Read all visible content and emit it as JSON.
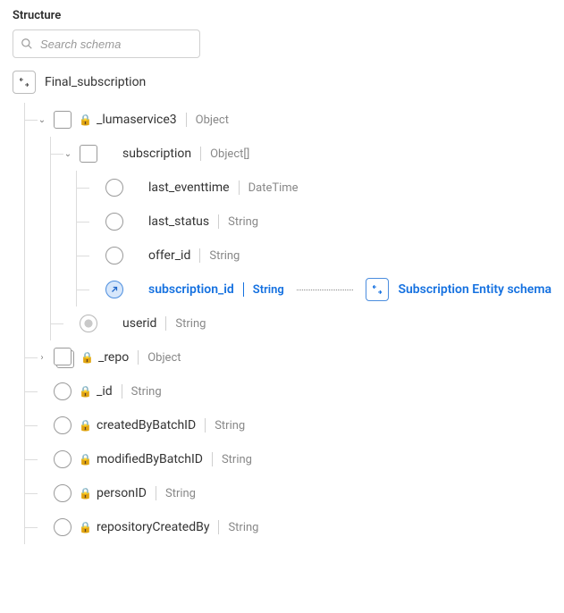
{
  "section_title": "Structure",
  "search": {
    "placeholder": "Search schema"
  },
  "schema": {
    "root": "Final_subscription",
    "n0": {
      "name": "_lumaservice3",
      "type": "Object"
    },
    "n0_0": {
      "name": "subscription",
      "type": "Object[]"
    },
    "n0_0_0": {
      "name": "last_eventtime",
      "type": "DateTime"
    },
    "n0_0_1": {
      "name": "last_status",
      "type": "String"
    },
    "n0_0_2": {
      "name": "offer_id",
      "type": "String"
    },
    "n0_0_3": {
      "name": "subscription_id",
      "type": "String",
      "ref": "Subscription Entity schema"
    },
    "n0_1": {
      "name": "userid",
      "type": "String"
    },
    "n1": {
      "name": "_repo",
      "type": "Object"
    },
    "n2": {
      "name": "_id",
      "type": "String"
    },
    "n3": {
      "name": "createdByBatchID",
      "type": "String"
    },
    "n4": {
      "name": "modifiedByBatchID",
      "type": "String"
    },
    "n5": {
      "name": "personID",
      "type": "String"
    },
    "n6": {
      "name": "repositoryCreatedBy",
      "type": "String"
    }
  }
}
